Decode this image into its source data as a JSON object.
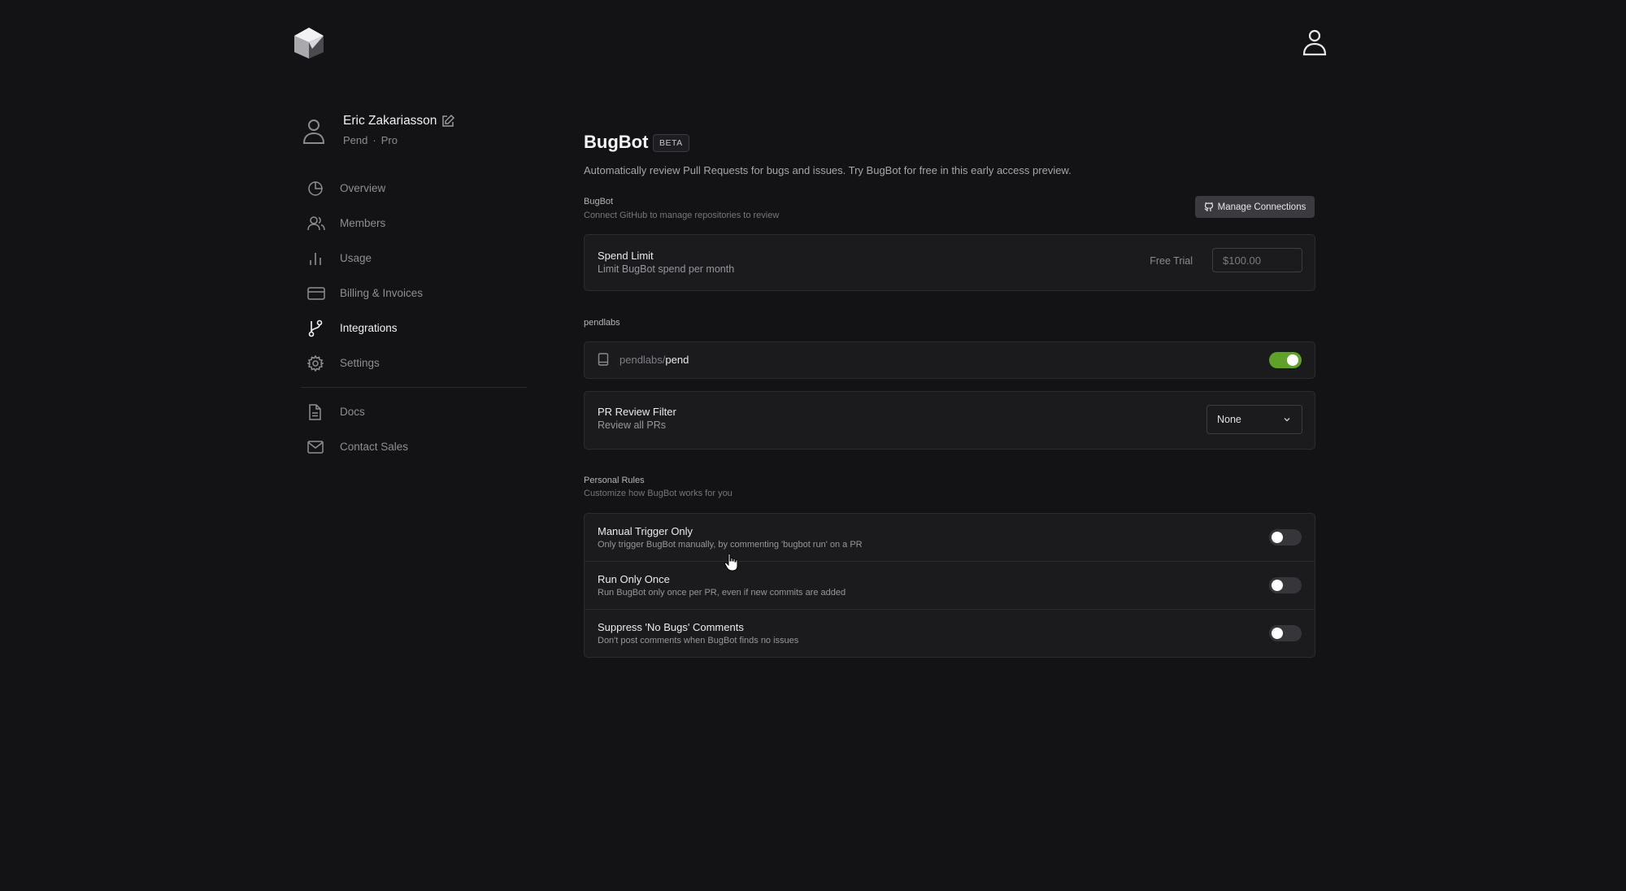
{
  "user": {
    "name": "Eric Zakariasson",
    "org": "Pend",
    "plan": "Pro"
  },
  "nav": {
    "items": [
      {
        "label": "Overview",
        "icon": "pie-chart-icon",
        "active": false
      },
      {
        "label": "Members",
        "icon": "users-icon",
        "active": false
      },
      {
        "label": "Usage",
        "icon": "bar-chart-icon",
        "active": false
      },
      {
        "label": "Billing & Invoices",
        "icon": "credit-card-icon",
        "active": false
      },
      {
        "label": "Integrations",
        "icon": "git-branch-icon",
        "active": true
      },
      {
        "label": "Settings",
        "icon": "gear-icon",
        "active": false
      }
    ],
    "secondary": [
      {
        "label": "Docs",
        "icon": "document-icon"
      },
      {
        "label": "Contact Sales",
        "icon": "mail-icon"
      }
    ]
  },
  "page": {
    "title": "BugBot",
    "badge": "BETA",
    "subtitle": "Automatically review Pull Requests for bugs and issues. Try BugBot for free in this early access preview."
  },
  "bugbot_section": {
    "label": "BugBot",
    "sub": "Connect GitHub to manage repositories to review",
    "manage_button": "Manage Connections"
  },
  "spend_limit": {
    "title": "Spend Limit",
    "desc": "Limit BugBot spend per month",
    "status": "Free Trial",
    "placeholder": "$100.00"
  },
  "org_section": {
    "label": "pendlabs",
    "repo_org": "pendlabs/",
    "repo_name": "pend",
    "enabled": true
  },
  "pr_filter": {
    "title": "PR Review Filter",
    "desc": "Review all PRs",
    "selected": "None"
  },
  "personal_rules": {
    "label": "Personal Rules",
    "sub": "Customize how BugBot works for you",
    "rules": [
      {
        "title": "Manual Trigger Only",
        "desc": "Only trigger BugBot manually, by commenting 'bugbot run' on a PR",
        "enabled": false
      },
      {
        "title": "Run Only Once",
        "desc": "Run BugBot only once per PR, even if new commits are added",
        "enabled": false
      },
      {
        "title": "Suppress 'No Bugs' Comments",
        "desc": "Don't post comments when BugBot finds no issues",
        "enabled": false
      }
    ]
  },
  "colors": {
    "accent_green": "#5fa229",
    "background": "#131315",
    "card": "#1b1b1e"
  }
}
